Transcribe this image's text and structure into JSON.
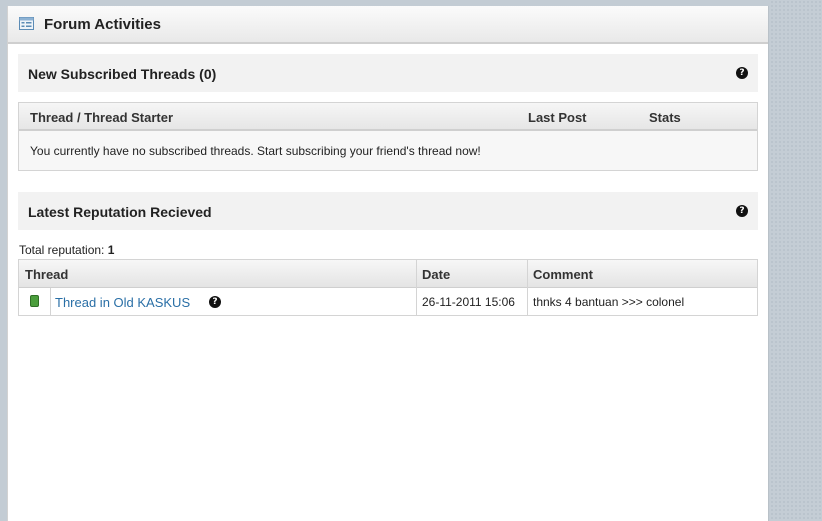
{
  "panel": {
    "title": "Forum Activities",
    "icon": "list-panel-icon"
  },
  "subscribed_threads": {
    "title": "New Subscribed Threads (0)",
    "help_glyph": "?",
    "columns": [
      "Thread / Thread Starter",
      "Last Post",
      "Stats"
    ],
    "empty_message": "You currently have no subscribed threads. Start subscribing your friend's thread now!"
  },
  "reputation": {
    "title": "Latest Reputation Recieved",
    "help_glyph": "?",
    "total_label": "Total reputation: ",
    "total_value": "1",
    "columns": [
      "Thread",
      "Date",
      "Comment"
    ],
    "rows": [
      {
        "status_color": "#4b9e3c",
        "thread": "Thread in Old KASKUS",
        "help_glyph": "?",
        "date": "26-11-2011 15:06",
        "comment": "thnks 4 bantuan >>> colonel"
      }
    ]
  },
  "colors": {
    "link": "#2a6fa6",
    "page_background": "#c3ccd4",
    "positive_reputation": "#4b9e3c"
  }
}
